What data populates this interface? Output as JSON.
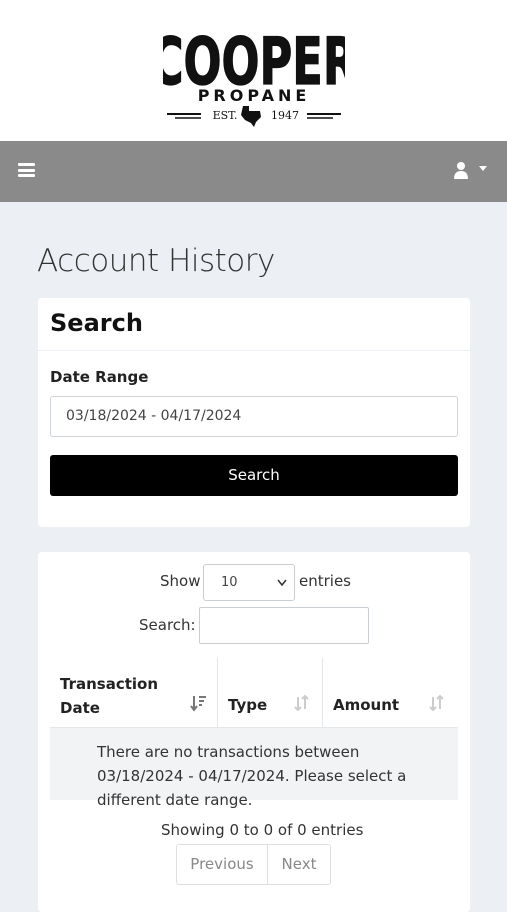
{
  "brand": {
    "name": "COOPER",
    "sub": "PROPANE",
    "est_left": "EST.",
    "est_right": "1947"
  },
  "page": {
    "title": "Account History"
  },
  "search_card": {
    "title": "Search",
    "date_range_label": "Date Range",
    "date_range_value": "03/18/2024 - 04/17/2024",
    "search_button": "Search"
  },
  "table": {
    "show_label": "Show",
    "page_length": "10",
    "entries_label": "entries",
    "filter_label": "Search:",
    "filter_value": "",
    "columns": [
      "Transaction Date",
      "Type",
      "Amount"
    ],
    "empty_message": "There are no transactions between 03/18/2024 - 04/17/2024. Please select a different date range.",
    "info": "Showing 0 to 0 of 0 entries",
    "prev_label": "Previous",
    "next_label": "Next"
  },
  "colors": {
    "navbar": "#8a8a8a",
    "background": "#eceff3",
    "primary_button": "#000000"
  },
  "icons": {
    "menu": "hamburger-icon",
    "user": "user-icon",
    "dropdown": "caret-down-icon",
    "sort_desc": "sort-desc-icon",
    "sort_both": "sort-both-icon"
  }
}
